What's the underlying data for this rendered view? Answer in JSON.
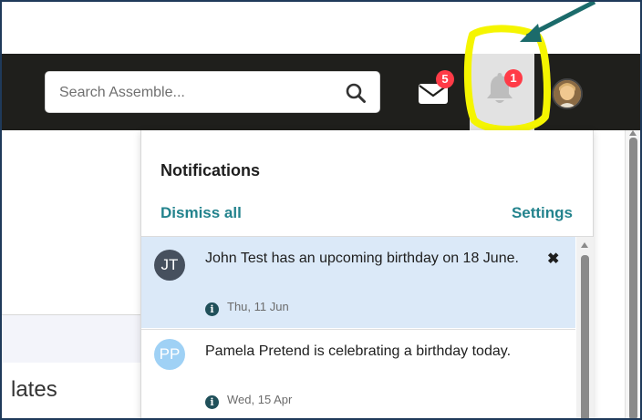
{
  "header": {
    "search": {
      "placeholder": "Search Assemble..."
    },
    "mail": {
      "icon": "envelope-icon",
      "badge": "5"
    },
    "notifications": {
      "icon": "bell-icon",
      "badge": "1"
    },
    "user": {
      "icon": "user-avatar"
    }
  },
  "annotations": {
    "highlight_color": "#f5f500",
    "arrow_color": "#1b6b6b"
  },
  "background": {
    "partial_text": "lates"
  },
  "notifications_panel": {
    "title": "Notifications",
    "dismiss_all": "Dismiss all",
    "settings": "Settings",
    "items": [
      {
        "initials": "JT",
        "avatar_color": "#46505e",
        "text": "John Test has an upcoming birthday on 18 June.",
        "date": "Thu, 11 Jun",
        "highlighted": true,
        "dismiss_icon": "close-icon"
      },
      {
        "initials": "PP",
        "avatar_color": "#9fd1f5",
        "text": "Pamela Pretend is celebrating a birthday today.",
        "date": "Wed, 15 Apr",
        "highlighted": false
      }
    ]
  },
  "colors": {
    "accent": "#23838d",
    "badge": "#ff3b47",
    "topbar": "#1f1f1c",
    "highlight_row": "#dbe9f8"
  }
}
